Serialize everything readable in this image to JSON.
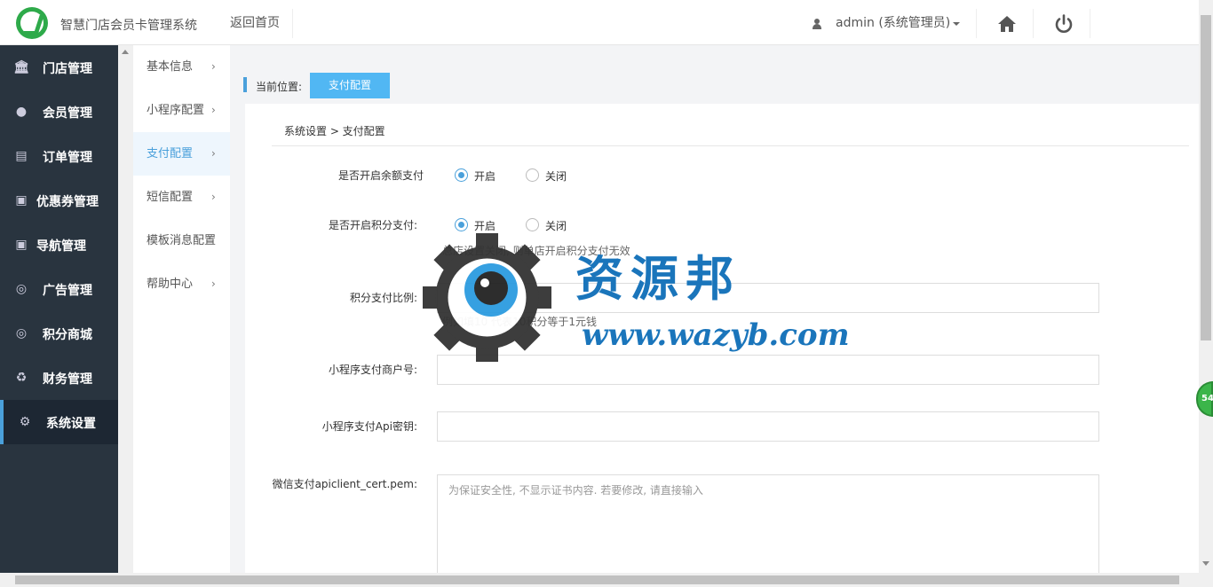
{
  "header": {
    "app_title": "智慧门店会员卡管理系统",
    "back_home": "返回首页",
    "user": "admin (系统管理员)"
  },
  "sidebar": {
    "items": [
      {
        "label": "门店管理",
        "icon": "bank-icon"
      },
      {
        "label": "会员管理",
        "icon": "user-icon"
      },
      {
        "label": "订单管理",
        "icon": "document-icon"
      },
      {
        "label": "优惠券管理",
        "icon": "money-icon"
      },
      {
        "label": "导航管理",
        "icon": "money-icon"
      },
      {
        "label": "广告管理",
        "icon": "lifebuoy-icon"
      },
      {
        "label": "积分商城",
        "icon": "lifebuoy-icon"
      },
      {
        "label": "财务管理",
        "icon": "recycle-icon"
      },
      {
        "label": "系统设置",
        "icon": "gear-icon"
      }
    ],
    "active": "系统设置"
  },
  "submenu": {
    "items": [
      {
        "label": "基本信息",
        "arrow": "›"
      },
      {
        "label": "小程序配置",
        "arrow": "›"
      },
      {
        "label": "支付配置",
        "arrow": "›"
      },
      {
        "label": "短信配置",
        "arrow": "›"
      },
      {
        "label": "模板消息配置",
        "arrow": ""
      },
      {
        "label": "帮助中心",
        "arrow": "›"
      }
    ],
    "active": "支付配置"
  },
  "breadcrumb": {
    "label": "当前位置:",
    "current": "支付配置"
  },
  "panel": {
    "title": "系统设置 > 支付配置"
  },
  "form": {
    "balance_pay": {
      "label": "是否开启余额支付",
      "on": "开启",
      "off": "关闭",
      "value": "开启"
    },
    "points_pay": {
      "label": "是否开启积分支付:",
      "on": "开启",
      "off": "关闭",
      "value": "开启",
      "hint": "总店设置关闭, 则单店开启积分支付无效"
    },
    "points_ratio": {
      "label": "积分支付比例:",
      "value": "",
      "hint": "例如填10 代表10积分等于1元钱"
    },
    "mch_id": {
      "label": "小程序支付商户号:",
      "value": ""
    },
    "api_key": {
      "label": "小程序支付Api密钥:",
      "value": ""
    },
    "cert_pem": {
      "label": "微信支付apiclient_cert.pem:",
      "placeholder": "为保证安全性, 不显示证书内容. 若要修改, 请直接输入"
    }
  },
  "floating_badge": "54",
  "watermark": {
    "title": "资源邦",
    "url": "www.wazyb.com"
  },
  "colors": {
    "accent": "#4aa0db",
    "sidebar_bg": "#29343f",
    "button": "#51b7f3"
  }
}
